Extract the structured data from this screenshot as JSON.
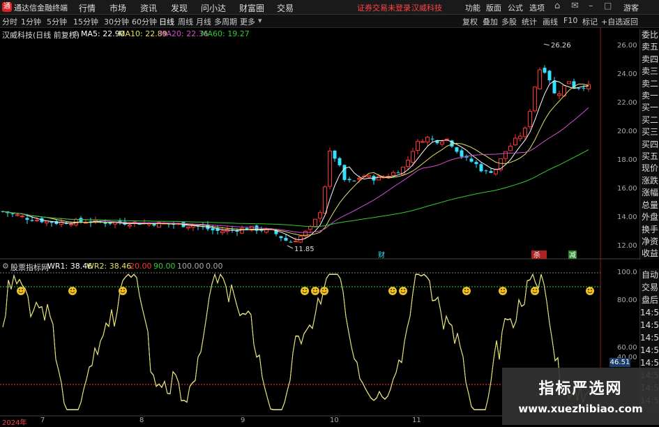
{
  "menubar": {
    "app_title": "通达信金融终端",
    "items": [
      "行情",
      "市场",
      "资讯",
      "发现",
      "问小达",
      "财富圈",
      "交易"
    ],
    "notice": "证券交易未登录",
    "stock": "汉威科技",
    "right_items": [
      "功能",
      "版面",
      "公式",
      "选项"
    ],
    "guest": "游客"
  },
  "toolbar": {
    "periods": [
      "分时",
      "1分钟",
      "5分钟",
      "15分钟",
      "30分钟",
      "60分钟",
      "日线",
      "周线",
      "月线",
      "多周期",
      "更多"
    ],
    "active_period": "日线",
    "right_buttons": [
      "复权",
      "叠加",
      "多股",
      "统计",
      "画线",
      "F10",
      "标记",
      "+自选",
      "返回"
    ]
  },
  "main_info": {
    "stock_label": "汉威科技(日线 前复权)",
    "ma5": "MA5: 22.90",
    "ma10": "MA10: 22.89",
    "ma20": "MA20: 22.36",
    "ma60": "MA60: 19.27"
  },
  "indicator_info": {
    "name": "股票指标网",
    "wr1": "WR1: 38.46",
    "wr2": "WR2: 38.46",
    "v1": "20.00",
    "v2": "90.00",
    "v3": "100.00",
    "v4": "0.00"
  },
  "price_axis": [
    "26.00",
    "24.00",
    "22.00",
    "20.00",
    "18.00",
    "16.00",
    "14.00",
    "12.00"
  ],
  "ind_axis": [
    "100.0",
    "80.00",
    "60.00",
    "40.00"
  ],
  "current_value": "46.51",
  "annotations": {
    "high": "26.26",
    "low": "11.85"
  },
  "date_axis": [
    "2024年",
    "7",
    "8",
    "9",
    "10",
    "11"
  ],
  "event_markers": [
    "财",
    "杀",
    "减"
  ],
  "right_panel_top": [
    "委比",
    "卖五",
    "卖四",
    "卖三",
    "卖二",
    "卖一",
    "买一",
    "买二",
    "买三",
    "买四",
    "买五",
    "现价",
    "涨跌",
    "涨幅",
    "总量",
    "外盘",
    "换手",
    "净资",
    "收益"
  ],
  "right_panel_bottom": [
    "自动",
    "交易",
    "盘后",
    "14:50",
    "14:50",
    "14:50",
    "14:50",
    "14:50",
    "14:50",
    "14:50",
    "14:50"
  ],
  "watermark": {
    "title": "指标严选网",
    "url": "www.xuezhibiao.com"
  },
  "colors": {
    "up": "#ff3333",
    "down": "#33e0ff",
    "ma5": "#ffffff",
    "ma10": "#e6e060",
    "ma20": "#d050d0",
    "ma60": "#33cc33",
    "wr": "#e6e060",
    "bg": "#000000"
  }
}
